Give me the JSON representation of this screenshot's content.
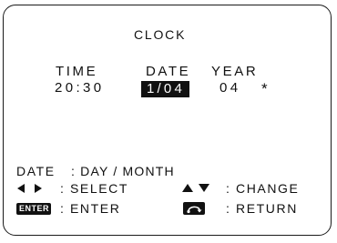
{
  "screen_title": "CLOCK",
  "columns": {
    "time_label": "TIME",
    "date_label": "DATE",
    "year_label": "YEAR"
  },
  "values": {
    "time": "20:30",
    "date": "1/04",
    "year": "04",
    "marker": "*"
  },
  "help": {
    "date_format_label": "DATE",
    "date_format_value": ": DAY / MONTH",
    "select_label": ": SELECT",
    "change_label": ": CHANGE",
    "enter_key": "ENTER",
    "enter_label": ": ENTER",
    "return_label": ": RETURN"
  },
  "icons": {
    "left": "left-triangle-icon",
    "right": "right-triangle-icon",
    "up": "up-triangle-icon",
    "down": "down-triangle-icon",
    "enter": "enter-key-icon",
    "return": "return-key-icon"
  },
  "colors": {
    "foreground": "#111111",
    "background": "#ffffff",
    "selection_bg": "#111111",
    "selection_fg": "#ffffff"
  }
}
